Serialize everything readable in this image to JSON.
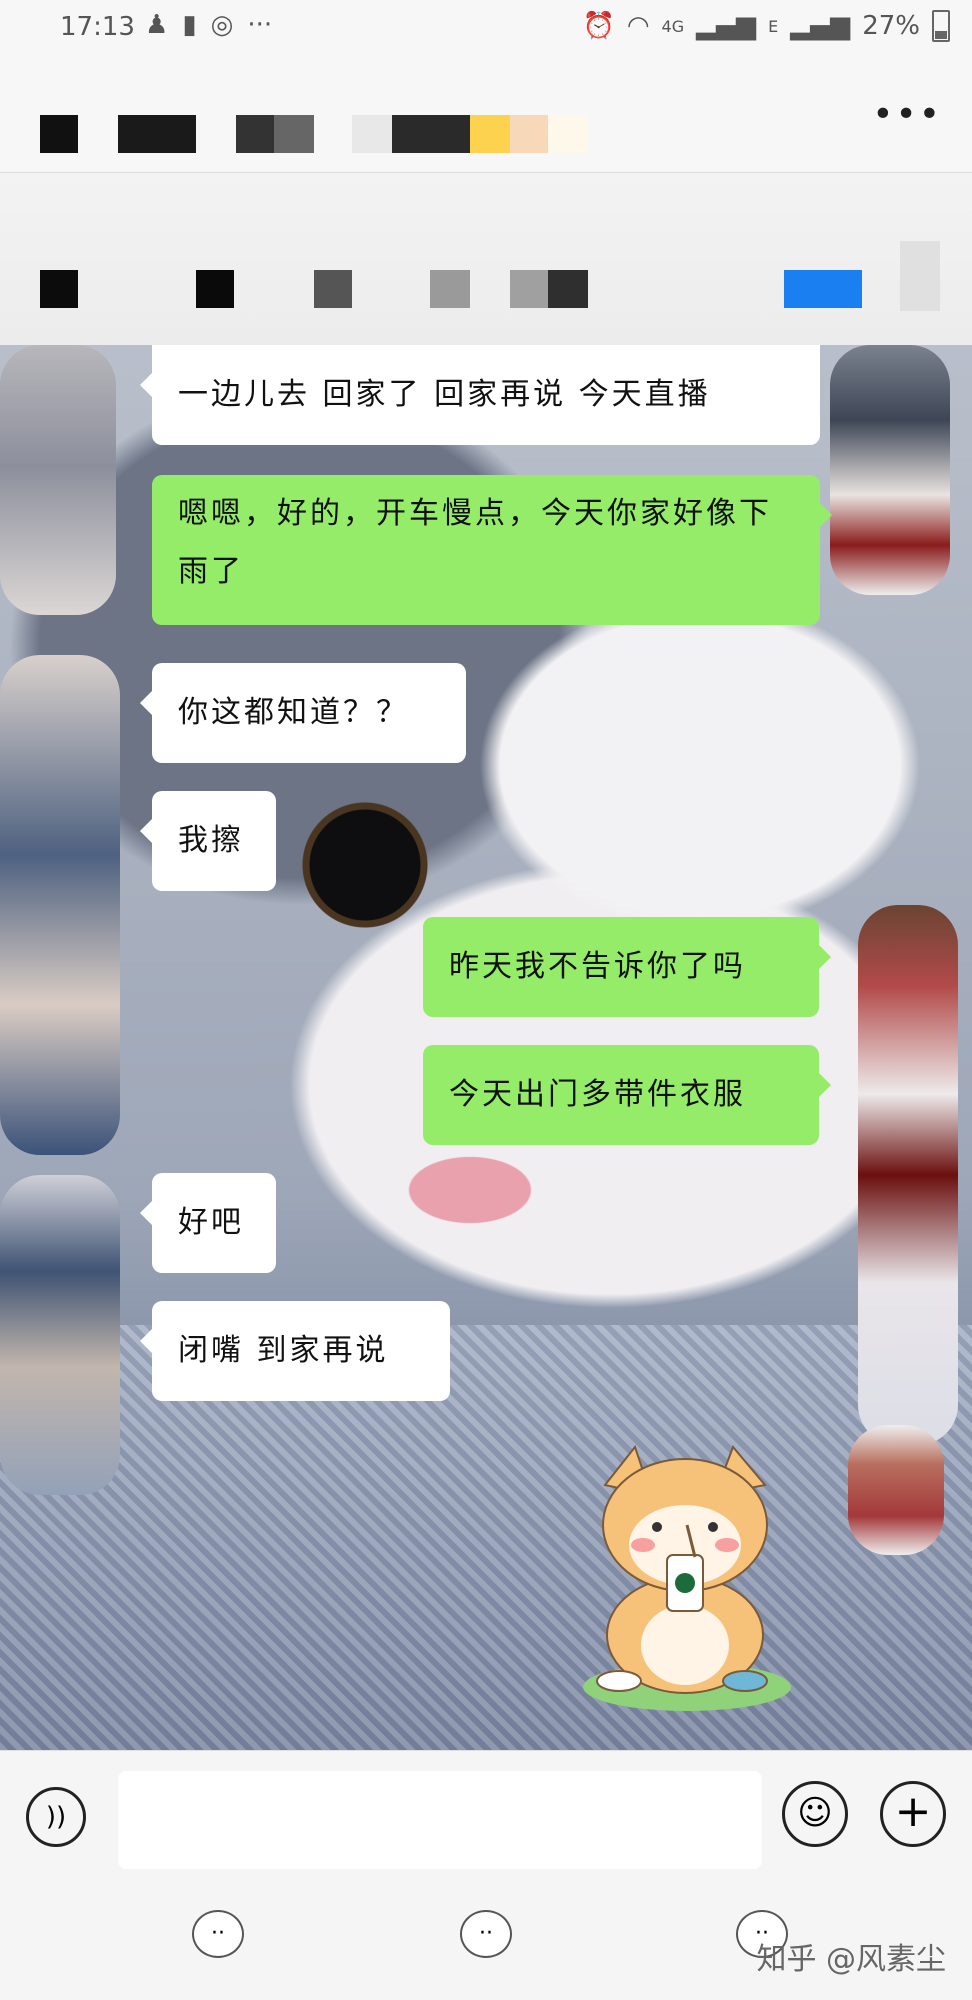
{
  "status_bar": {
    "time": "17:13",
    "left_icons": [
      "app-icon",
      "chat-bubble-icon",
      "weibo-icon",
      "more-dots-icon"
    ],
    "network": "4G",
    "network2": "E",
    "battery": "27%"
  },
  "header": {
    "more_label": "•••"
  },
  "messages": [
    {
      "side": "left",
      "text": "一边儿去 回家了 回家再说 今天直播"
    },
    {
      "side": "right",
      "text": "嗯嗯，好的，开车慢点，今天你家好像下雨了"
    },
    {
      "side": "left",
      "text": "你这都知道？？"
    },
    {
      "side": "left",
      "text": "我擦"
    },
    {
      "side": "right",
      "text": "昨天我不告诉你了吗"
    },
    {
      "side": "right",
      "text": "今天出门多带件衣服"
    },
    {
      "side": "left",
      "text": "好吧"
    },
    {
      "side": "left",
      "text": "闭嘴 到家再说"
    }
  ],
  "input": {
    "value": "",
    "voice_icon": "))",
    "emoji_icon": "☺",
    "plus_icon": "+"
  },
  "watermark": "知乎 @风素尘",
  "colors": {
    "bubble_green": "#95ec69",
    "bubble_white": "#ffffff",
    "accent_blue": "#1a7ff0"
  }
}
